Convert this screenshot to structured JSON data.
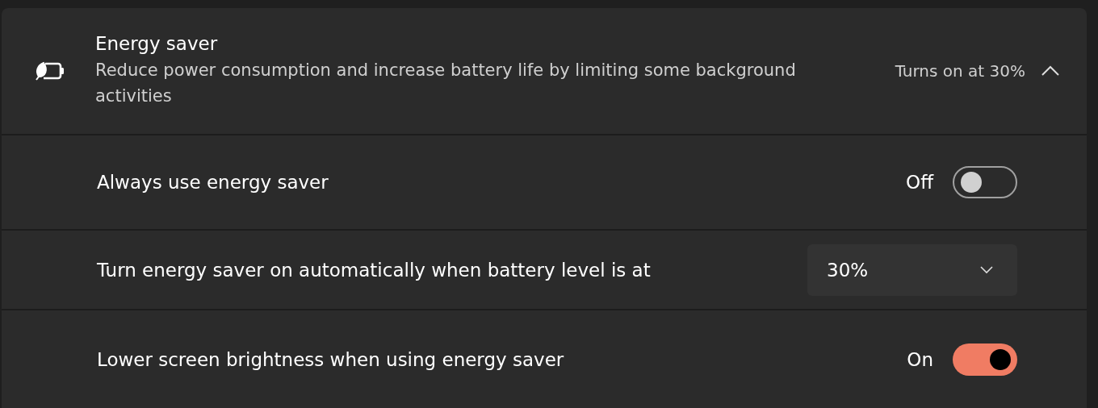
{
  "header": {
    "title": "Energy saver",
    "description": "Reduce power consumption and increase battery life by limiting some background activities",
    "status": "Turns on at 30%",
    "expanded": true
  },
  "rows": [
    {
      "kind": "toggle",
      "label": "Always use energy saver",
      "state_text": "Off",
      "on": false
    },
    {
      "kind": "dropdown",
      "label": "Turn energy saver on automatically when battery level is at",
      "value": "30%"
    },
    {
      "kind": "toggle",
      "label": "Lower screen brightness when using energy saver",
      "state_text": "On",
      "on": true
    }
  ]
}
